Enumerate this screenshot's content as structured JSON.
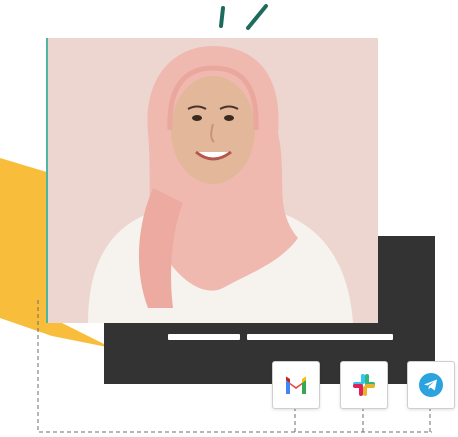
{
  "illustration": {
    "photo_subject": "person-portrait",
    "colors": {
      "yellow": "#f7bd3b",
      "dark_card": "#333333",
      "photo_background": "#ecd6cf",
      "hijab": "#f0b9b0",
      "accent_teal": "#1e6b5e",
      "frame_accent": "#4fb6a4"
    }
  },
  "apps": [
    {
      "icon": "gmail-icon"
    },
    {
      "icon": "slack-icon"
    },
    {
      "icon": "telegram-icon"
    }
  ]
}
